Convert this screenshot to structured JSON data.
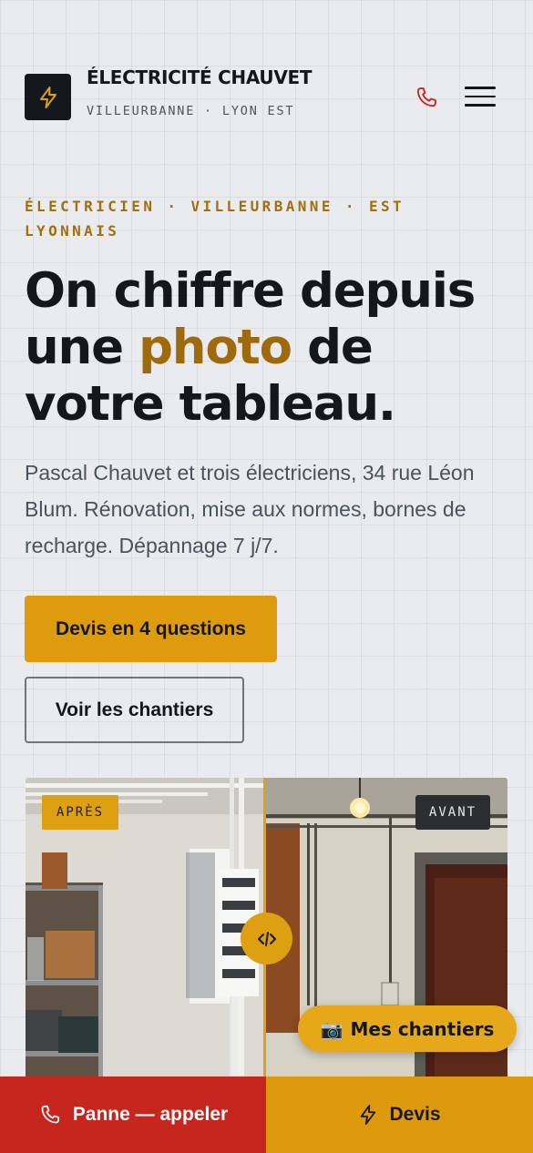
{
  "header": {
    "brand_title": "ÉLECTRICITÉ CHAUVET",
    "brand_subtitle": "VILLEURBANNE · LYON EST",
    "logo_icon": "lightning-bolt-icon",
    "phone_icon": "phone-icon",
    "menu_icon": "hamburger-menu-icon"
  },
  "hero": {
    "eyebrow": "ÉLECTRICIEN · VILLEURBANNE · EST LYONNAIS",
    "headline_part1": "On chiffre depuis une ",
    "headline_accent": "photo",
    "headline_part2": " de votre tableau.",
    "intro": "Pascal Chauvet et trois électriciens, 34 rue Léon Blum. Rénovation, mise aux normes, bornes de recharge. Dépannage 7 j/7.",
    "primary_cta": "Devis en 4 questions",
    "secondary_cta": "Voir les chantiers"
  },
  "compare": {
    "after_label": "APRÈS",
    "before_label": "AVANT",
    "handle_icon": "drag-handle-icon"
  },
  "floating": {
    "icon": "📷",
    "label": "Mes chantiers"
  },
  "bottom_bar": {
    "call_label": "Panne — appeler",
    "devis_label": "Devis"
  },
  "colors": {
    "accent": "#de9b0c",
    "accent_text": "#9e6a0c",
    "danger": "#c7261e",
    "ink": "#14171c",
    "background": "#e9ebee"
  }
}
